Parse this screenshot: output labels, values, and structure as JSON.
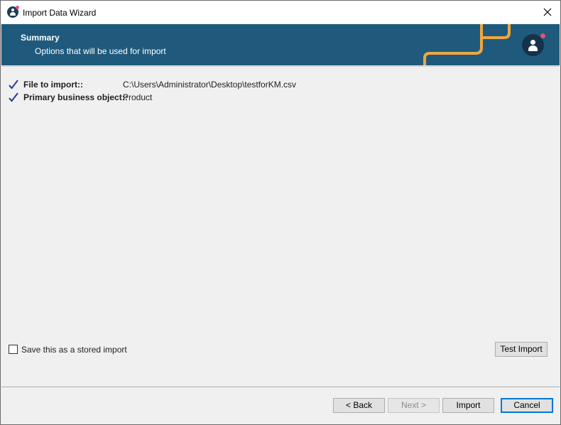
{
  "window": {
    "title": "Import Data Wizard"
  },
  "banner": {
    "title": "Summary",
    "subtitle": "Options that will be used for import",
    "accent_color": "#f0a640",
    "background_color": "#1f5a7c"
  },
  "summary": {
    "items": [
      {
        "label": "File to import::",
        "value": "C:\\Users\\Administrator\\Desktop\\testforKM.csv",
        "icon": "checkmark-icon"
      },
      {
        "label": "Primary business object::",
        "value": "Product",
        "icon": "checkmark-icon"
      }
    ]
  },
  "options": {
    "stored_import_label": "Save this as a stored import",
    "stored_import_checked": false
  },
  "buttons": {
    "test_import": "Test Import",
    "back": "< Back",
    "next": "Next >",
    "import": "Import",
    "cancel": "Cancel"
  }
}
